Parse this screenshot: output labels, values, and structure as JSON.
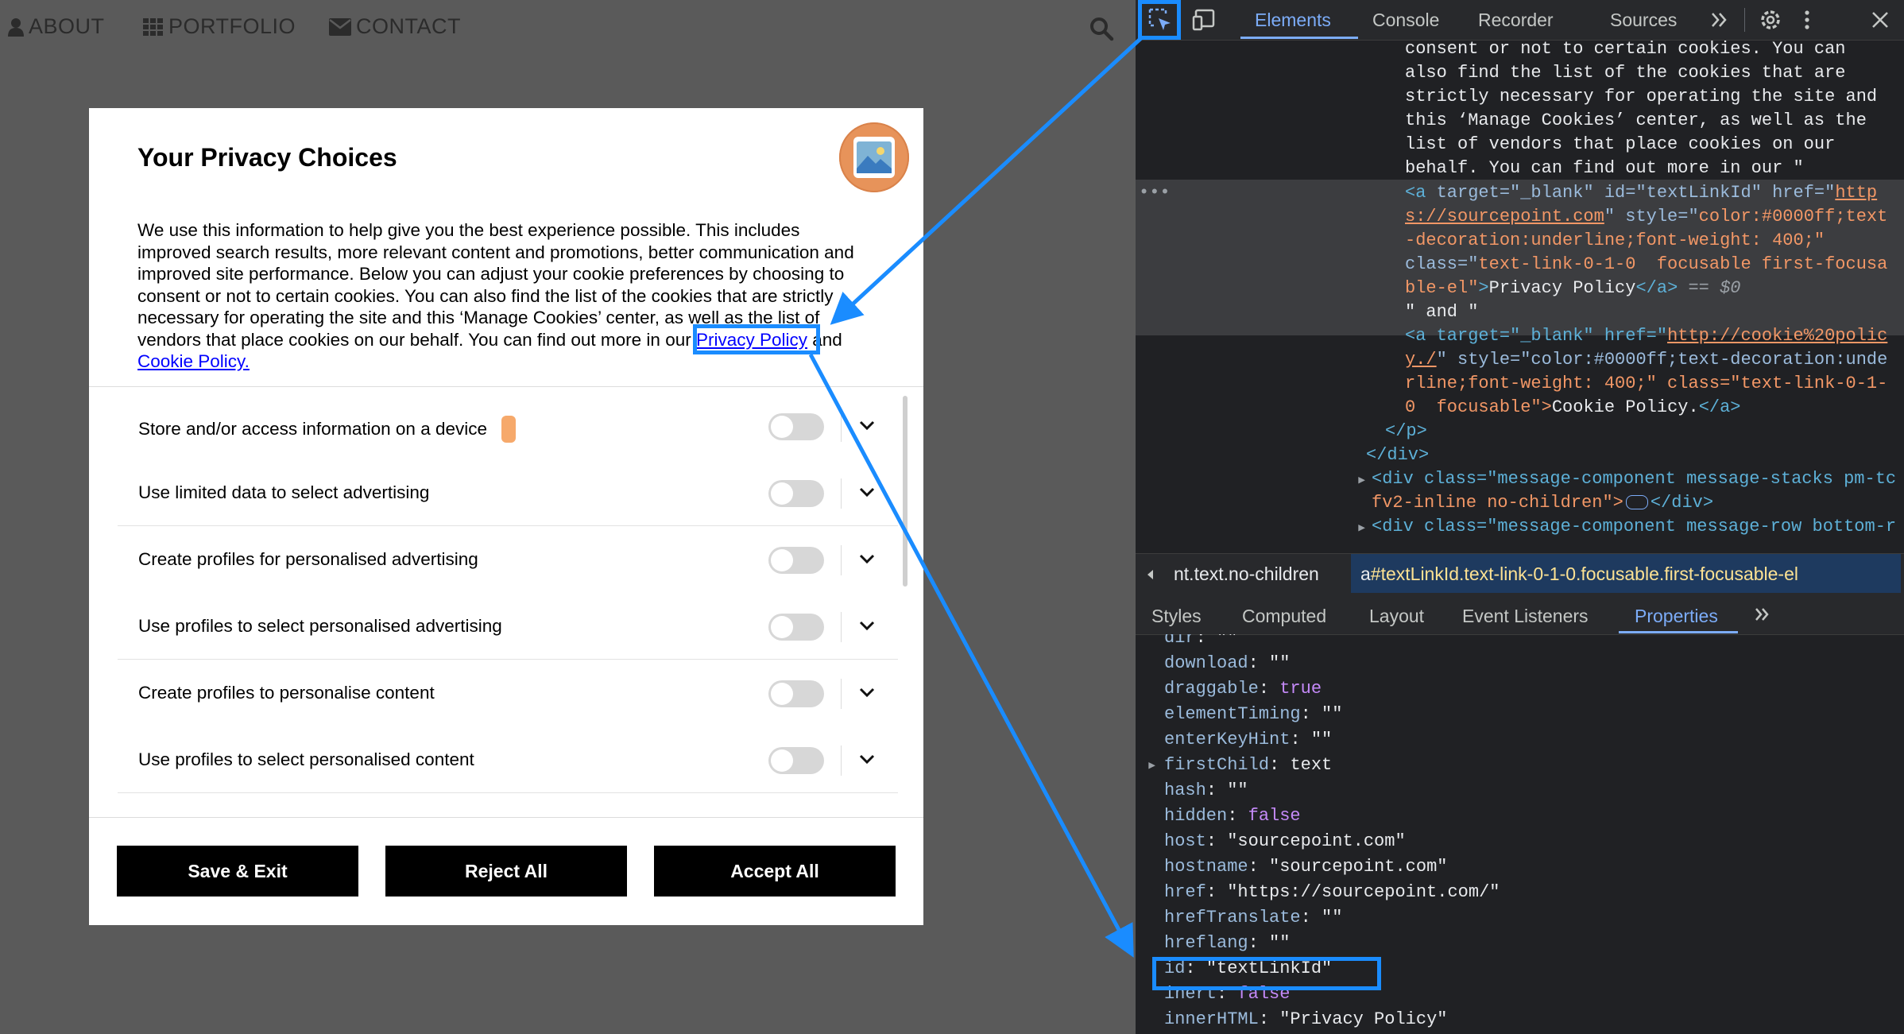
{
  "site": {
    "nav": [
      {
        "label": "ABOUT",
        "icon": "user-icon"
      },
      {
        "label": "PORTFOLIO",
        "icon": "grid-icon"
      },
      {
        "label": "CONTACT",
        "icon": "envelope-icon"
      }
    ],
    "search_icon": "search-icon"
  },
  "dialog": {
    "title": "Your Privacy Choices",
    "description_before_link": "We use this information to help give you the best experience possible. This includes improved search results, more relevant content and promotions, better communication and improved site performance. Below you can adjust your cookie preferences by choosing to consent or not to certain cookies. You can also find the list of the cookies that are strictly necessary for operating the site and this ‘Manage Cookies’ center, as well as the list of vendors that place cookies on our behalf. You can find out more in our ",
    "privacy_link": "Privacy Policy",
    "and_text": " and ",
    "cookie_link": "Cookie Policy.",
    "purposes": [
      {
        "label": "Store and/or access information on a device"
      },
      {
        "label": "Use limited data to select advertising"
      },
      {
        "label": "Create profiles for personalised advertising"
      },
      {
        "label": "Use profiles to select personalised advertising"
      },
      {
        "label": "Create profiles to personalise content"
      },
      {
        "label": "Use profiles to select personalised content"
      }
    ],
    "buttons": {
      "save": "Save & Exit",
      "reject": "Reject All",
      "accept": "Accept All"
    }
  },
  "devtools": {
    "tabs": [
      "Elements",
      "Console",
      "Recorder",
      "Sources"
    ],
    "active_tab": "Elements",
    "dom_lines": [
      {
        "text": "consent or not to certain cookies. You can"
      },
      {
        "text": "also find the list of the cookies that are"
      },
      {
        "text": "strictly necessary for operating the site and"
      },
      {
        "text": "this ‘Manage Cookies’ center, as well as the"
      },
      {
        "text": "list of vendors that place cookies on our"
      },
      {
        "text": "behalf. You can find out more in our \""
      },
      {
        "text": "\" and \""
      },
      {
        "text": "</p>"
      },
      {
        "text": "</div>"
      }
    ],
    "selected_anchor": {
      "tag_open": "<a",
      "target": "target=\"_blank\"",
      "id": "id=\"textLinkId\"",
      "href_label": "href=\"",
      "href1": "http",
      "href2": "s://sourcepoint.com",
      "style_label": "style=\"",
      "style_val1": "color:#0000ff;text",
      "style_val2": "-decoration:underline;font-weight: 400;\"",
      "class_label": "class=\"",
      "class_val1": "text-link-0-1-0  focusable first-focusa",
      "class_val2": "ble-el\"",
      "text": "Privacy Policy",
      "close": "</a>",
      "eq": " == $0"
    },
    "second_anchor": {
      "line1_a": "<a target=\"_blank\" href=\"",
      "line1_link": "http://cookie%20polic",
      "line2_link": "y./",
      "line2_rest": "\" style=\"color:#0000ff;text-decoration:unde",
      "line3": "rline;font-weight: 400;\" class=\"text-link-0-1-",
      "line4_a": "0  focusable\">",
      "line4_text": "Cookie Policy.",
      "line4_close": "</a>"
    },
    "div_lines": [
      "<div class=\"message-component message-stacks pm-tc",
      "fv2-inline no-children\">",
      "</div>",
      "<div class=\"message-component message-row bottom-r"
    ],
    "breadcrumb": {
      "left": "nt.text.no-children",
      "right_tag": "a",
      "right": "#textLinkId.text-link-0-1-0.focusable.first-focusable-el"
    },
    "sub_tabs": [
      "Styles",
      "Computed",
      "Layout",
      "Event Listeners",
      "Properties"
    ],
    "active_sub_tab": "Properties",
    "properties": [
      {
        "key": "dir",
        "value": "\"\"",
        "type": "str"
      },
      {
        "key": "download",
        "value": "\"\"",
        "type": "str"
      },
      {
        "key": "draggable",
        "value": "true",
        "type": "bool"
      },
      {
        "key": "elementTiming",
        "value": "\"\"",
        "type": "str"
      },
      {
        "key": "enterKeyHint",
        "value": "\"\"",
        "type": "str"
      },
      {
        "key": "firstChild",
        "value": "text",
        "type": "obj"
      },
      {
        "key": "hash",
        "value": "\"\"",
        "type": "str"
      },
      {
        "key": "hidden",
        "value": "false",
        "type": "bool"
      },
      {
        "key": "host",
        "value": "\"sourcepoint.com\"",
        "type": "str"
      },
      {
        "key": "hostname",
        "value": "\"sourcepoint.com\"",
        "type": "str"
      },
      {
        "key": "href",
        "value": "\"https://sourcepoint.com/\"",
        "type": "str"
      },
      {
        "key": "hrefTranslate",
        "value": "\"\"",
        "type": "str"
      },
      {
        "key": "hreflang",
        "value": "\"\"",
        "type": "str"
      },
      {
        "key": "id",
        "value": "\"textLinkId\"",
        "type": "str"
      },
      {
        "key": "inert",
        "value": "false",
        "type": "bool"
      },
      {
        "key": "innerHTML",
        "value": "\"Privacy Policy\"",
        "type": "str"
      }
    ]
  },
  "colors": {
    "highlight": "#1a8cff",
    "link": "#0000ff",
    "devtools_bg": "#202124"
  }
}
